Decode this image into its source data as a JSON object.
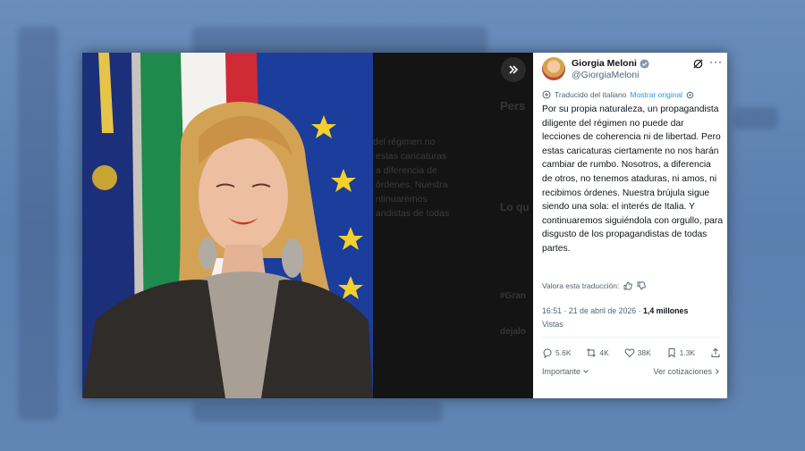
{
  "background": {
    "blurred_texts": [
      "Pers",
      "Lo qu",
      "dejalo",
      "#Gran"
    ]
  },
  "modal": {
    "expand_icon": "double-chevron-right-icon",
    "ghost_text": "del régimen no\n estas caricaturas\n a diferencia de\n órdenes. Nuestra\n ntinuaremos\n andistas de todas"
  },
  "tweet": {
    "author_name": "Giorgia Meloni",
    "author_handle": "@GiorgiaMeloni",
    "translated_label": "Traducido del italiano",
    "show_original": "Mostrar original",
    "body": "Por su propia naturaleza, un propagandista diligente del régimen no puede dar lecciones de coherencia ni de libertad. Pero estas caricaturas ciertamente no nos harán cambiar de rumbo. Nosotros, a diferencia de otros, no tenemos ataduras, ni amos, ni recibimos órdenes. Nuestra brújula sigue siendo una sola: el interés de Italia. Y continuaremos siguiéndola con orgullo, para disgusto de los propagandistas de todas partes.",
    "rate_label": "Valora esta traducción:",
    "timestamp": "16:51 · 21 de abril de 2026 ·",
    "views_count": "1,4 millones",
    "views_label": "Vistas",
    "replies": "5.6K",
    "reposts": "4K",
    "likes": "38K",
    "bookmarks": "1.3K",
    "relevance_label": "Importante",
    "quotes_label": "Ver cotizaciones"
  },
  "colors": {
    "accent": "#1d9bf0",
    "verified": "#1d9bf0",
    "secondary_text": "#536471"
  }
}
